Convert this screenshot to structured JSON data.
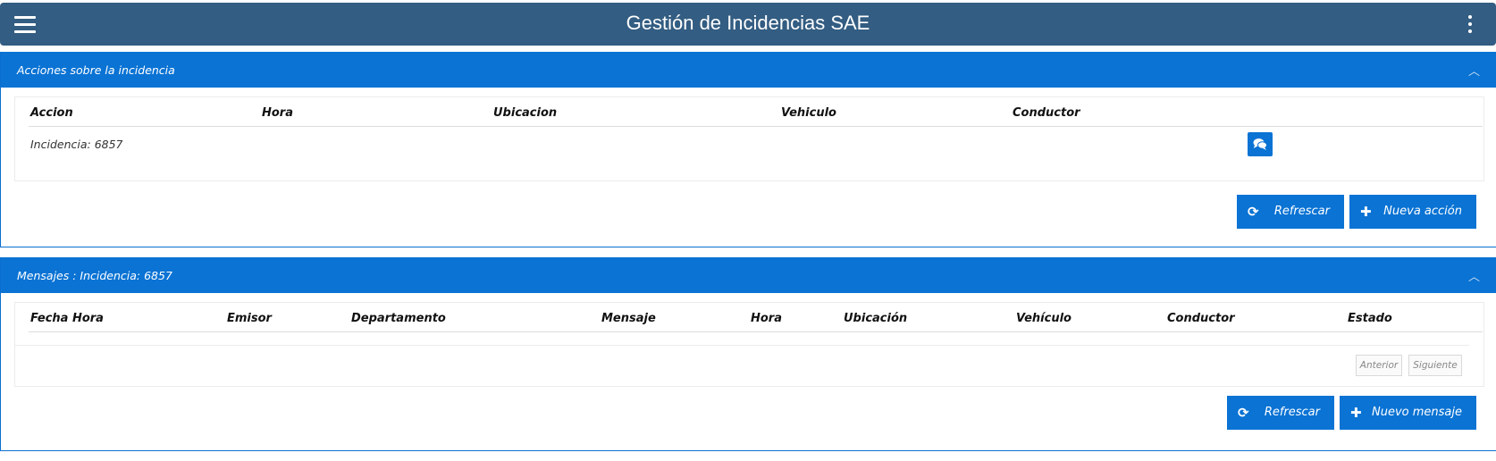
{
  "app": {
    "title": "Gestión de Incidencias SAE"
  },
  "acciones_panel": {
    "title": "Acciones sobre la incidencia",
    "columns": [
      "Accion",
      "Hora",
      "Ubicacion",
      "Vehiculo",
      "Conductor"
    ],
    "rows": [
      {
        "accion": "Incidencia: 6857"
      }
    ],
    "refresh_label": "Refrescar",
    "new_label": "Nueva acción"
  },
  "mensajes_panel": {
    "title": "Mensajes : Incidencia: 6857",
    "columns": [
      "Fecha Hora",
      "Emisor",
      "Departamento",
      "Mensaje",
      "Hora",
      "Ubicación",
      "Vehículo",
      "Conductor",
      "Estado"
    ],
    "pager": {
      "prev": "Anterior",
      "next": "Siguiente"
    },
    "refresh_label": "Refrescar",
    "new_label": "Nuevo mensaje"
  },
  "colors": {
    "topbar": "#335d82",
    "accent": "#0a73d4"
  }
}
